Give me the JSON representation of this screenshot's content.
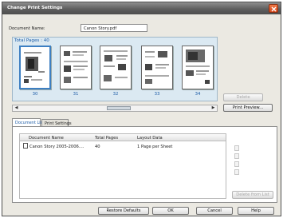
{
  "window": {
    "title": "Change Print Settings"
  },
  "document": {
    "name_label": "Document Name:",
    "name_value": "Canon Story.pdf"
  },
  "thumbnails": {
    "total_label": "Total Pages : 40",
    "pages": [
      "30",
      "31",
      "32",
      "33",
      "34"
    ]
  },
  "buttons": {
    "delete": "Delete",
    "print_preview": "Print Preview...",
    "delete_from_list": "Delete from List",
    "restore_defaults": "Restore Defaults",
    "ok": "OK",
    "cancel": "Cancel",
    "help": "Help"
  },
  "tabs": [
    "Document List",
    "Print Settings"
  ],
  "doc_list": {
    "columns": [
      "Document Name",
      "Total Pages",
      "Layout Data"
    ],
    "rows": [
      {
        "name": "Canon Story 2005-2006....",
        "pages": "40",
        "layout": "1 Page per Sheet"
      }
    ]
  },
  "colors": {
    "accent": "#1f5ea8",
    "panel": "#dbe9f2",
    "close": "#e05a2a"
  }
}
